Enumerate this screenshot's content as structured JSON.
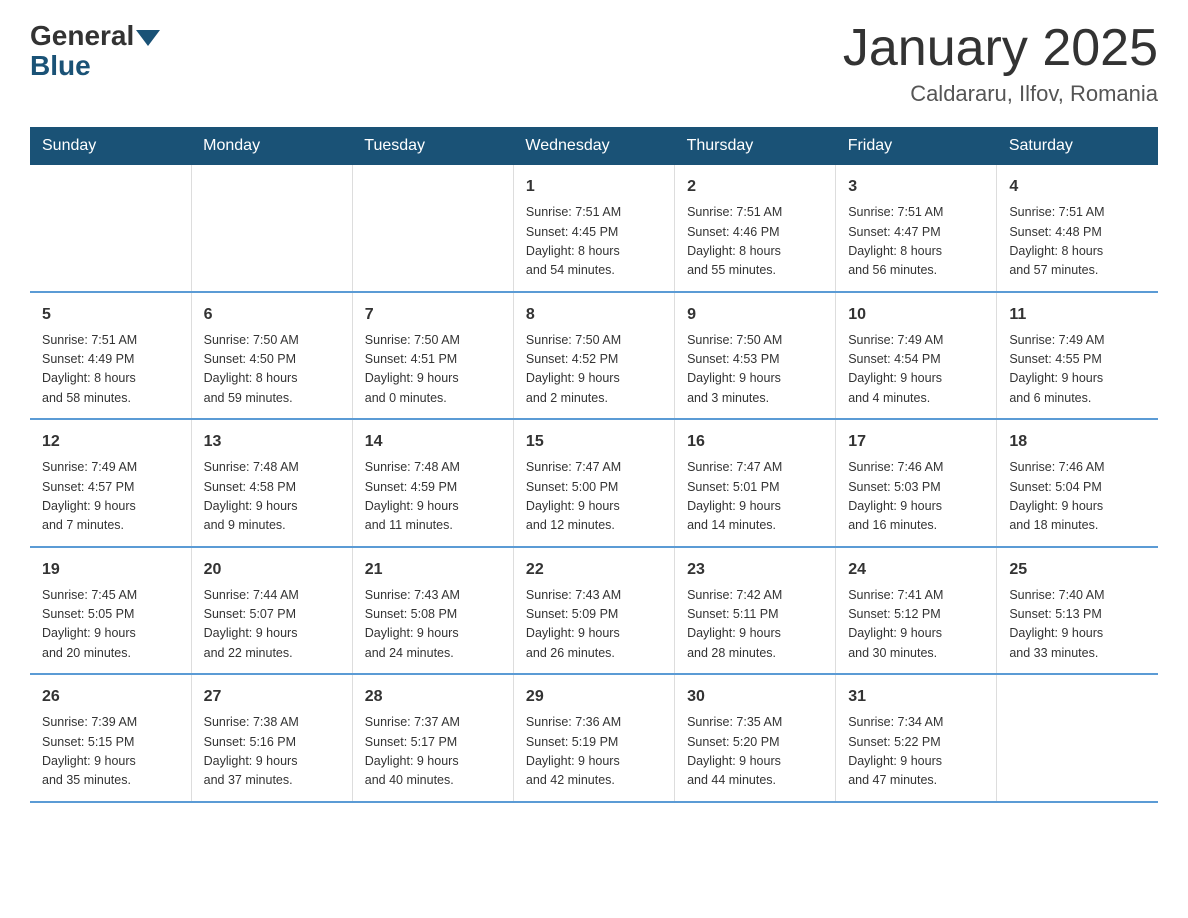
{
  "logo": {
    "general": "General",
    "blue": "Blue"
  },
  "header": {
    "title": "January 2025",
    "location": "Caldararu, Ilfov, Romania"
  },
  "days_of_week": [
    "Sunday",
    "Monday",
    "Tuesday",
    "Wednesday",
    "Thursday",
    "Friday",
    "Saturday"
  ],
  "weeks": [
    [
      {
        "day": "",
        "info": ""
      },
      {
        "day": "",
        "info": ""
      },
      {
        "day": "",
        "info": ""
      },
      {
        "day": "1",
        "info": "Sunrise: 7:51 AM\nSunset: 4:45 PM\nDaylight: 8 hours\nand 54 minutes."
      },
      {
        "day": "2",
        "info": "Sunrise: 7:51 AM\nSunset: 4:46 PM\nDaylight: 8 hours\nand 55 minutes."
      },
      {
        "day": "3",
        "info": "Sunrise: 7:51 AM\nSunset: 4:47 PM\nDaylight: 8 hours\nand 56 minutes."
      },
      {
        "day": "4",
        "info": "Sunrise: 7:51 AM\nSunset: 4:48 PM\nDaylight: 8 hours\nand 57 minutes."
      }
    ],
    [
      {
        "day": "5",
        "info": "Sunrise: 7:51 AM\nSunset: 4:49 PM\nDaylight: 8 hours\nand 58 minutes."
      },
      {
        "day": "6",
        "info": "Sunrise: 7:50 AM\nSunset: 4:50 PM\nDaylight: 8 hours\nand 59 minutes."
      },
      {
        "day": "7",
        "info": "Sunrise: 7:50 AM\nSunset: 4:51 PM\nDaylight: 9 hours\nand 0 minutes."
      },
      {
        "day": "8",
        "info": "Sunrise: 7:50 AM\nSunset: 4:52 PM\nDaylight: 9 hours\nand 2 minutes."
      },
      {
        "day": "9",
        "info": "Sunrise: 7:50 AM\nSunset: 4:53 PM\nDaylight: 9 hours\nand 3 minutes."
      },
      {
        "day": "10",
        "info": "Sunrise: 7:49 AM\nSunset: 4:54 PM\nDaylight: 9 hours\nand 4 minutes."
      },
      {
        "day": "11",
        "info": "Sunrise: 7:49 AM\nSunset: 4:55 PM\nDaylight: 9 hours\nand 6 minutes."
      }
    ],
    [
      {
        "day": "12",
        "info": "Sunrise: 7:49 AM\nSunset: 4:57 PM\nDaylight: 9 hours\nand 7 minutes."
      },
      {
        "day": "13",
        "info": "Sunrise: 7:48 AM\nSunset: 4:58 PM\nDaylight: 9 hours\nand 9 minutes."
      },
      {
        "day": "14",
        "info": "Sunrise: 7:48 AM\nSunset: 4:59 PM\nDaylight: 9 hours\nand 11 minutes."
      },
      {
        "day": "15",
        "info": "Sunrise: 7:47 AM\nSunset: 5:00 PM\nDaylight: 9 hours\nand 12 minutes."
      },
      {
        "day": "16",
        "info": "Sunrise: 7:47 AM\nSunset: 5:01 PM\nDaylight: 9 hours\nand 14 minutes."
      },
      {
        "day": "17",
        "info": "Sunrise: 7:46 AM\nSunset: 5:03 PM\nDaylight: 9 hours\nand 16 minutes."
      },
      {
        "day": "18",
        "info": "Sunrise: 7:46 AM\nSunset: 5:04 PM\nDaylight: 9 hours\nand 18 minutes."
      }
    ],
    [
      {
        "day": "19",
        "info": "Sunrise: 7:45 AM\nSunset: 5:05 PM\nDaylight: 9 hours\nand 20 minutes."
      },
      {
        "day": "20",
        "info": "Sunrise: 7:44 AM\nSunset: 5:07 PM\nDaylight: 9 hours\nand 22 minutes."
      },
      {
        "day": "21",
        "info": "Sunrise: 7:43 AM\nSunset: 5:08 PM\nDaylight: 9 hours\nand 24 minutes."
      },
      {
        "day": "22",
        "info": "Sunrise: 7:43 AM\nSunset: 5:09 PM\nDaylight: 9 hours\nand 26 minutes."
      },
      {
        "day": "23",
        "info": "Sunrise: 7:42 AM\nSunset: 5:11 PM\nDaylight: 9 hours\nand 28 minutes."
      },
      {
        "day": "24",
        "info": "Sunrise: 7:41 AM\nSunset: 5:12 PM\nDaylight: 9 hours\nand 30 minutes."
      },
      {
        "day": "25",
        "info": "Sunrise: 7:40 AM\nSunset: 5:13 PM\nDaylight: 9 hours\nand 33 minutes."
      }
    ],
    [
      {
        "day": "26",
        "info": "Sunrise: 7:39 AM\nSunset: 5:15 PM\nDaylight: 9 hours\nand 35 minutes."
      },
      {
        "day": "27",
        "info": "Sunrise: 7:38 AM\nSunset: 5:16 PM\nDaylight: 9 hours\nand 37 minutes."
      },
      {
        "day": "28",
        "info": "Sunrise: 7:37 AM\nSunset: 5:17 PM\nDaylight: 9 hours\nand 40 minutes."
      },
      {
        "day": "29",
        "info": "Sunrise: 7:36 AM\nSunset: 5:19 PM\nDaylight: 9 hours\nand 42 minutes."
      },
      {
        "day": "30",
        "info": "Sunrise: 7:35 AM\nSunset: 5:20 PM\nDaylight: 9 hours\nand 44 minutes."
      },
      {
        "day": "31",
        "info": "Sunrise: 7:34 AM\nSunset: 5:22 PM\nDaylight: 9 hours\nand 47 minutes."
      },
      {
        "day": "",
        "info": ""
      }
    ]
  ]
}
